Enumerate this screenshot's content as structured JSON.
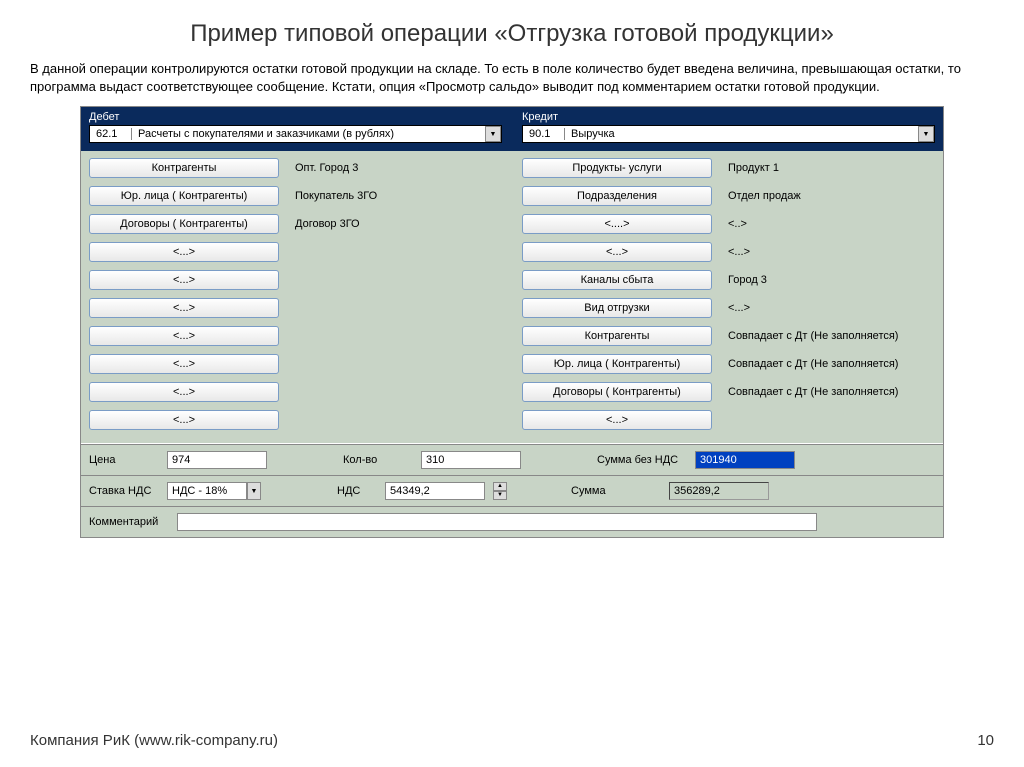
{
  "title": "Пример типовой операции «Отгрузка готовой продукции»",
  "description": "В данной операции контролируются остатки готовой продукции на складе. То есть в поле количество будет введена величина, превышающая остатки, то программа выдаст соответствующее сообщение. Кстати, опция «Просмотр сальдо» выводит под комментарием остатки готовой продукции.",
  "header": {
    "debit_label": "Дебет",
    "credit_label": "Кредит",
    "debit_code": "62.1",
    "debit_text": "Расчеты с покупателями и заказчиками (в рублях)",
    "credit_code": "90.1",
    "credit_text": "Выручка"
  },
  "debit_rows": [
    {
      "btn": "Контрагенты",
      "val": "Опт. Город 3"
    },
    {
      "btn": "Юр. лица   ( Контрагенты)",
      "val": "Покупатель 3ГО"
    },
    {
      "btn": "Договоры  ( Контрагенты)",
      "val": "Договор 3ГО"
    },
    {
      "btn": "<...>",
      "val": ""
    },
    {
      "btn": "<...>",
      "val": ""
    },
    {
      "btn": "<...>",
      "val": ""
    },
    {
      "btn": "<...>",
      "val": ""
    },
    {
      "btn": "<...>",
      "val": ""
    },
    {
      "btn": "<...>",
      "val": ""
    },
    {
      "btn": "<...>",
      "val": ""
    }
  ],
  "credit_rows": [
    {
      "btn": "Продукты- услуги",
      "val": "Продукт 1"
    },
    {
      "btn": "Подразделения",
      "val": "Отдел продаж"
    },
    {
      "btn": "<....>",
      "val": "<..>"
    },
    {
      "btn": "<...>",
      "val": "<...>"
    },
    {
      "btn": "Каналы сбыта",
      "val": "Город 3"
    },
    {
      "btn": "Вид отгрузки",
      "val": "<...>"
    },
    {
      "btn": "Контрагенты",
      "val": "Совпадает с Дт (Не заполняется)"
    },
    {
      "btn": "Юр. лица   ( Контрагенты)",
      "val": "Совпадает с Дт (Не заполняется)"
    },
    {
      "btn": "Договоры  ( Контрагенты)",
      "val": "Совпадает с Дт (Не заполняется)"
    },
    {
      "btn": "<...>",
      "val": ""
    }
  ],
  "fields": {
    "price_label": "Цена",
    "price_value": "974",
    "qty_label": "Кол-во",
    "qty_value": "310",
    "sum_novat_label": "Сумма без НДС",
    "sum_novat_value": "301940",
    "vat_rate_label": "Ставка НДС",
    "vat_rate_value": "НДС - 18%",
    "vat_label": "НДС",
    "vat_value": "54349,2",
    "sum_label": "Сумма",
    "sum_value": "356289,2",
    "comment_label": "Комментарий",
    "comment_value": ""
  },
  "footer": {
    "company": "Компания РиК (www.rik-company.ru)",
    "page": "10"
  }
}
